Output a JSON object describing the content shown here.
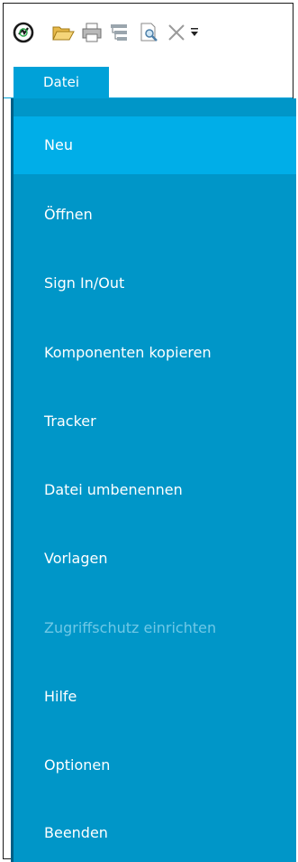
{
  "toolbar": {
    "icons": [
      "app-logo-icon",
      "open-folder-icon",
      "print-icon",
      "tree-structure-icon",
      "print-preview-icon",
      "close-icon",
      "customize-toolbar-icon"
    ]
  },
  "tabs": [
    {
      "label": "Datei",
      "active": true
    }
  ],
  "menu": {
    "items": [
      {
        "label": "Neu",
        "state": "active"
      },
      {
        "label": "Öffnen",
        "state": "normal"
      },
      {
        "label": "Sign In/Out",
        "state": "normal"
      },
      {
        "label": "Komponenten kopieren",
        "state": "normal"
      },
      {
        "label": "Tracker",
        "state": "normal"
      },
      {
        "label": "Datei umbenennen",
        "state": "normal"
      },
      {
        "label": "Vorlagen",
        "state": "normal"
      },
      {
        "label": "Zugriffschutz einrichten",
        "state": "disabled"
      },
      {
        "label": "Hilfe",
        "state": "normal"
      },
      {
        "label": "Optionen",
        "state": "normal"
      },
      {
        "label": "Beenden",
        "state": "normal"
      }
    ]
  },
  "colors": {
    "menu_background": "#0096c8",
    "menu_active": "#00aee8",
    "tab_background": "#00a1d8",
    "disabled_text": "#6fc8e6"
  }
}
